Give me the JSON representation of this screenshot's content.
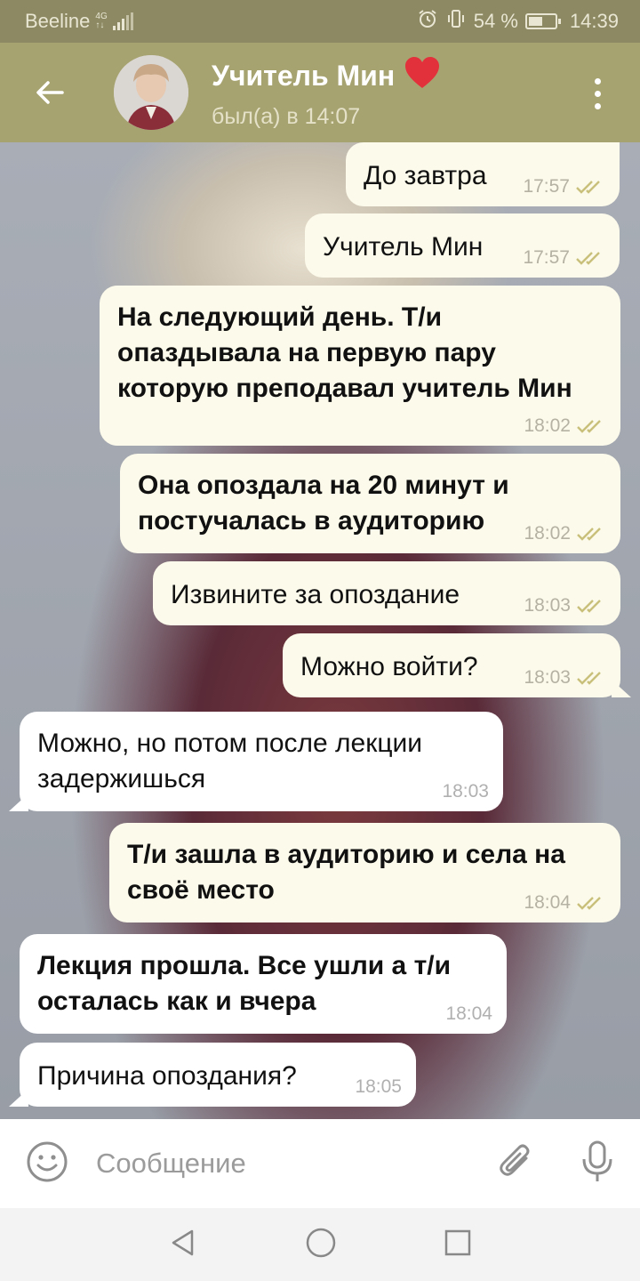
{
  "status_bar": {
    "carrier": "Beeline",
    "network_top": "4G",
    "network_bottom": "↑↓",
    "battery_percent": "54 %",
    "battery_level": 0.54,
    "time": "14:39"
  },
  "header": {
    "contact_name": "Учитель Мин",
    "heart": "❤",
    "last_seen": "был(а) в 14:07"
  },
  "colors": {
    "header_bg": "#a7a371",
    "outgoing_bubble": "#fcfaea",
    "incoming_bubble": "#ffffff",
    "read_check": "#c8c07a"
  },
  "messages": [
    {
      "dir": "out",
      "text": "До завтра",
      "time": "17:57",
      "read": true
    },
    {
      "dir": "out",
      "text": "Учитель Мин",
      "time": "17:57",
      "read": true
    },
    {
      "dir": "out",
      "text": "На следующий день. Т/и опаздывала на первую пару которую преподавал учитель Мин",
      "time": "18:02",
      "read": true,
      "bold": true
    },
    {
      "dir": "out",
      "text": "Она опоздала на 20 минут и постучалась в аудиторию",
      "time": "18:02",
      "read": true,
      "bold": true
    },
    {
      "dir": "out",
      "text": "Извините за опоздание",
      "time": "18:03",
      "read": true
    },
    {
      "dir": "out",
      "text": "Можно войти?",
      "time": "18:03",
      "read": true
    },
    {
      "dir": "in",
      "text": "Можно, но потом после лекции задержишься",
      "time": "18:03"
    },
    {
      "dir": "out",
      "text": "Т/и зашла в аудиторию и села на своё место",
      "time": "18:04",
      "read": true,
      "bold": true
    },
    {
      "dir": "in",
      "text": "Лекция прошла. Все ушли а т/и осталась как и вчера",
      "time": "18:04",
      "bold": true
    },
    {
      "dir": "in",
      "text": "Причина опоздания?",
      "time": "18:05"
    }
  ],
  "input": {
    "placeholder": "Сообщение"
  },
  "icons": {
    "back": "arrow-left-icon",
    "more": "more-vertical-icon",
    "emoji": "emoji-icon",
    "attach": "paperclip-icon",
    "mic": "microphone-icon",
    "nav_back": "nav-back-icon",
    "nav_home": "nav-home-icon",
    "nav_recent": "nav-recent-icon"
  }
}
